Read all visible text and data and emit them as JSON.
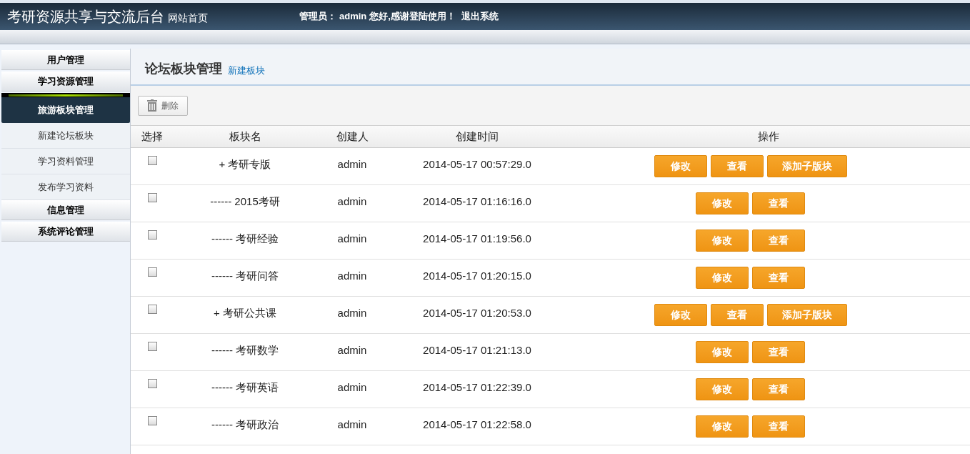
{
  "header": {
    "title": "考研资源共享与交流后台",
    "home_link": "网站首页",
    "greeting_label": "管理员：",
    "user": "admin",
    "greeting": "您好,感谢登陆使用！",
    "logout": "退出系统"
  },
  "sidebar": {
    "items": [
      {
        "kind": "group",
        "label": "用户管理",
        "selected": false
      },
      {
        "kind": "group",
        "label": "学习资源管理",
        "selected": false
      },
      {
        "kind": "group",
        "label": "旅游板块管理",
        "selected": true
      },
      {
        "kind": "link",
        "label": "新建论坛板块",
        "selected": false
      },
      {
        "kind": "link",
        "label": "学习资料管理",
        "selected": false
      },
      {
        "kind": "link",
        "label": "发布学习资料",
        "selected": false
      },
      {
        "kind": "group",
        "label": "信息管理",
        "selected": false
      },
      {
        "kind": "group",
        "label": "系统评论管理",
        "selected": false
      }
    ]
  },
  "page": {
    "title": "论坛板块管理",
    "new_link": "新建板块",
    "delete_button": "删除"
  },
  "table": {
    "columns": [
      "选择",
      "板块名",
      "创建人",
      "创建时间",
      "操作"
    ],
    "rows": [
      {
        "checked": false,
        "name": "+ 考研专版",
        "creator": "admin",
        "time": "2014-05-17 00:57:29.0",
        "actions": [
          "修改",
          "查看",
          "添加子版块"
        ]
      },
      {
        "checked": false,
        "name": "------ 2015考研",
        "creator": "admin",
        "time": "2014-05-17 01:16:16.0",
        "actions": [
          "修改",
          "查看"
        ]
      },
      {
        "checked": false,
        "name": "------ 考研经验",
        "creator": "admin",
        "time": "2014-05-17 01:19:56.0",
        "actions": [
          "修改",
          "查看"
        ]
      },
      {
        "checked": false,
        "name": "------ 考研问答",
        "creator": "admin",
        "time": "2014-05-17 01:20:15.0",
        "actions": [
          "修改",
          "查看"
        ]
      },
      {
        "checked": false,
        "name": "+ 考研公共课",
        "creator": "admin",
        "time": "2014-05-17 01:20:53.0",
        "actions": [
          "修改",
          "查看",
          "添加子版块"
        ]
      },
      {
        "checked": false,
        "name": "------ 考研数学",
        "creator": "admin",
        "time": "2014-05-17 01:21:13.0",
        "actions": [
          "修改",
          "查看"
        ]
      },
      {
        "checked": false,
        "name": "------ 考研英语",
        "creator": "admin",
        "time": "2014-05-17 01:22:39.0",
        "actions": [
          "修改",
          "查看"
        ]
      },
      {
        "checked": false,
        "name": "------ 考研政治",
        "creator": "admin",
        "time": "2014-05-17 01:22:58.0",
        "actions": [
          "修改",
          "查看"
        ]
      }
    ]
  }
}
